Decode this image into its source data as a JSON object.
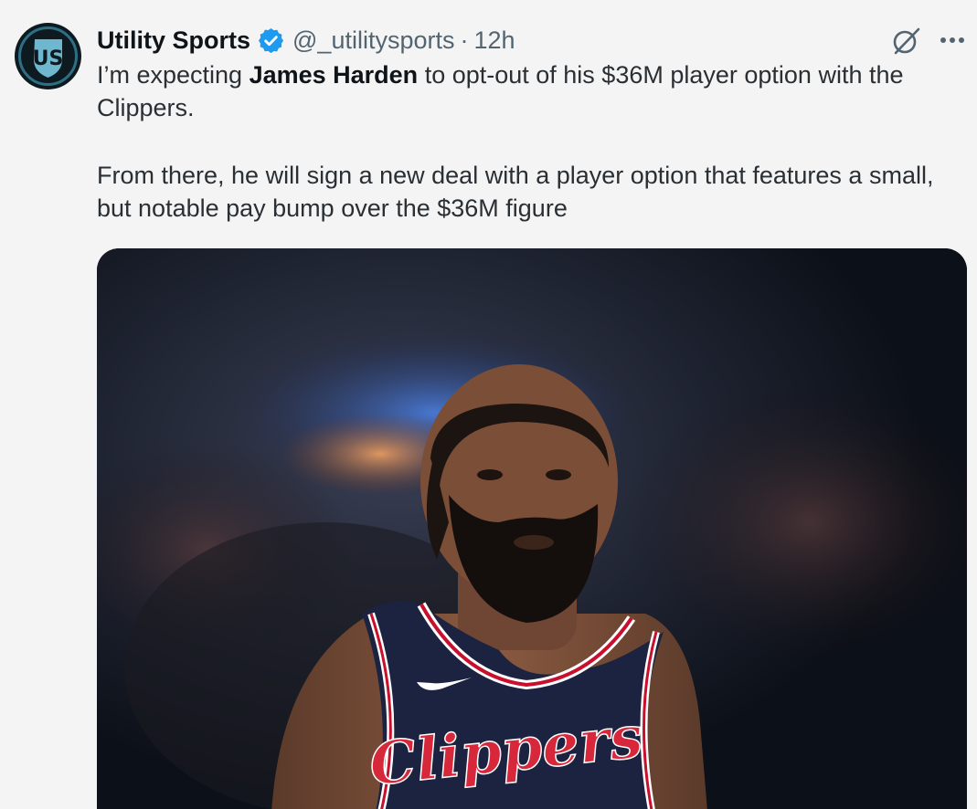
{
  "author": {
    "display_name": "Utility Sports",
    "handle": "@_utilitysports",
    "separator": "·",
    "time": "12h",
    "avatar_text": "US",
    "avatar_icon": "utility-sports-logo",
    "verified_icon": "verified-badge-icon"
  },
  "tweet": {
    "p1_before": "I’m expecting ",
    "p1_bold": "James Harden",
    "p1_after": " to opt-out of his $36M player option with the Clippers.",
    "p2": "From there, he will sign a new deal with a player option that features a small, but notable pay bump over the $36M figure"
  },
  "media": {
    "jersey_text": "Clippers",
    "description": "photo"
  },
  "icons": {
    "grok": "grok-icon",
    "more": "more-icon"
  },
  "colors": {
    "verified": "#1d9bf0",
    "text": "#0f1419",
    "secondary": "#536471",
    "jersey_navy": "#1c2340",
    "jersey_red": "#c8102e"
  }
}
